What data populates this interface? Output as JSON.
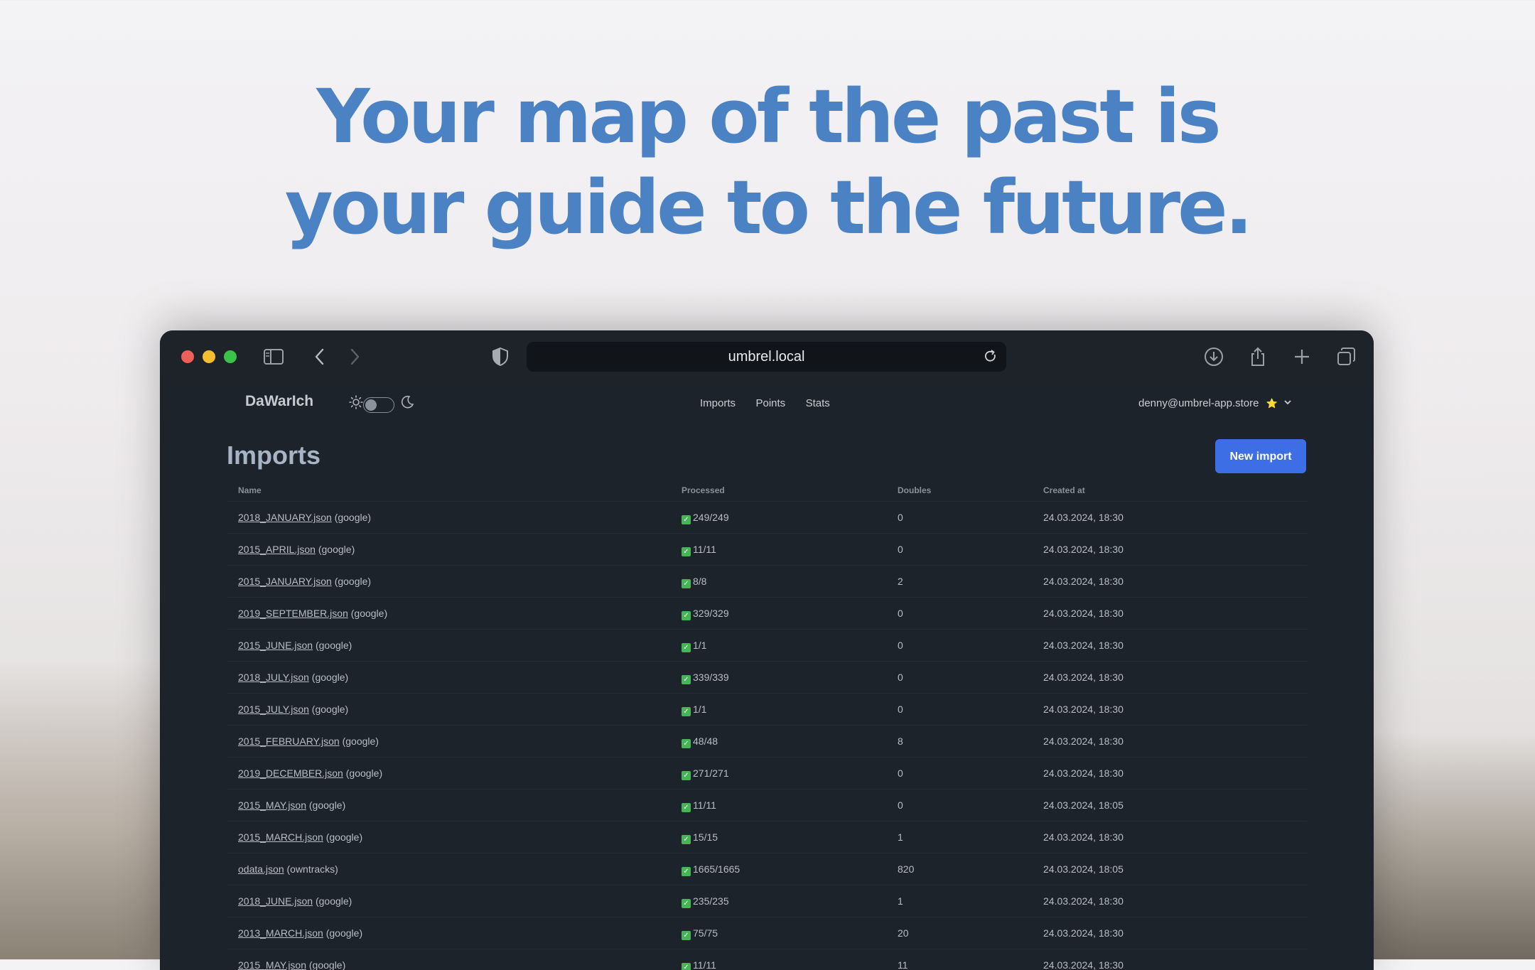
{
  "headline": {
    "line1": "Your map of the past is",
    "line2": "your guide to the future."
  },
  "browser": {
    "url": "umbrel.local"
  },
  "app": {
    "brand": "DaWarIch",
    "nav": [
      "Imports",
      "Points",
      "Stats"
    ],
    "user": "denny@umbrel-app.store",
    "user_badge": "⭐",
    "page_title": "Imports",
    "new_import_label": "New import"
  },
  "table": {
    "columns": [
      "Name",
      "Processed",
      "Doubles",
      "Created at"
    ],
    "rows": [
      {
        "file": "2018_JANUARY.json",
        "source": "(google)",
        "processed": "249/249",
        "doubles": "0",
        "created": "24.03.2024, 18:30"
      },
      {
        "file": "2015_APRIL.json",
        "source": "(google)",
        "processed": "11/11",
        "doubles": "0",
        "created": "24.03.2024, 18:30"
      },
      {
        "file": "2015_JANUARY.json",
        "source": "(google)",
        "processed": "8/8",
        "doubles": "2",
        "created": "24.03.2024, 18:30"
      },
      {
        "file": "2019_SEPTEMBER.json",
        "source": "(google)",
        "processed": "329/329",
        "doubles": "0",
        "created": "24.03.2024, 18:30"
      },
      {
        "file": "2015_JUNE.json",
        "source": "(google)",
        "processed": "1/1",
        "doubles": "0",
        "created": "24.03.2024, 18:30"
      },
      {
        "file": "2018_JULY.json",
        "source": "(google)",
        "processed": "339/339",
        "doubles": "0",
        "created": "24.03.2024, 18:30"
      },
      {
        "file": "2015_JULY.json",
        "source": "(google)",
        "processed": "1/1",
        "doubles": "0",
        "created": "24.03.2024, 18:30"
      },
      {
        "file": "2015_FEBRUARY.json",
        "source": "(google)",
        "processed": "48/48",
        "doubles": "8",
        "created": "24.03.2024, 18:30"
      },
      {
        "file": "2019_DECEMBER.json",
        "source": "(google)",
        "processed": "271/271",
        "doubles": "0",
        "created": "24.03.2024, 18:30"
      },
      {
        "file": "2015_MAY.json",
        "source": "(google)",
        "processed": "11/11",
        "doubles": "0",
        "created": "24.03.2024, 18:05"
      },
      {
        "file": "2015_MARCH.json",
        "source": "(google)",
        "processed": "15/15",
        "doubles": "1",
        "created": "24.03.2024, 18:30"
      },
      {
        "file": "odata.json",
        "source": "(owntracks)",
        "processed": "1665/1665",
        "doubles": "820",
        "created": "24.03.2024, 18:05"
      },
      {
        "file": "2018_JUNE.json",
        "source": "(google)",
        "processed": "235/235",
        "doubles": "1",
        "created": "24.03.2024, 18:30"
      },
      {
        "file": "2013_MARCH.json",
        "source": "(google)",
        "processed": "75/75",
        "doubles": "20",
        "created": "24.03.2024, 18:30"
      },
      {
        "file": "2015_MAY.json",
        "source": "(google)",
        "processed": "11/11",
        "doubles": "11",
        "created": "24.03.2024, 18:30"
      }
    ]
  }
}
